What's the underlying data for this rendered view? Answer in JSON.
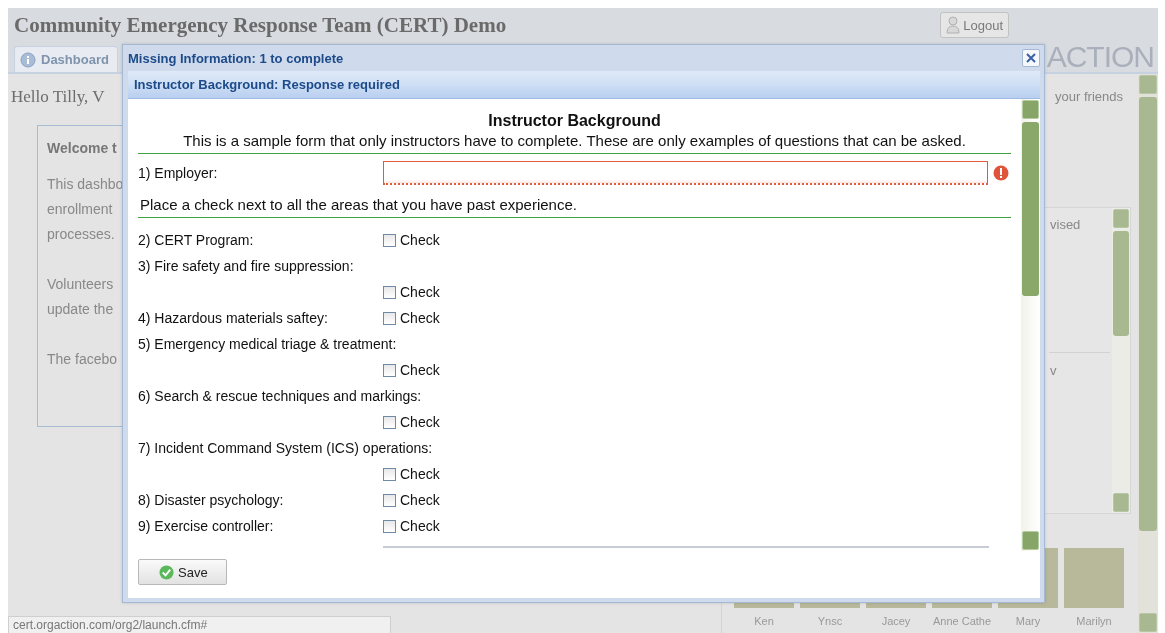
{
  "header": {
    "title": "Community Emergency Response Team (CERT) Demo",
    "logout": "Logout",
    "logo": "ACTION"
  },
  "tabs": [
    {
      "label": "Dashboard",
      "selected": true
    }
  ],
  "greeting": "Hello Tilly, V",
  "friends_label": "your friends",
  "welcome": {
    "title": "Welcome t",
    "paragraphs": [
      [
        "This dashbo",
        "enrollment",
        "processes."
      ],
      [
        "Volunteers",
        "update the"
      ],
      [
        "The facebo"
      ]
    ]
  },
  "side_panel": {
    "lines": [
      "vised",
      "v"
    ]
  },
  "people": [
    {
      "name": "Ken"
    },
    {
      "name": "Ynsc"
    },
    {
      "name": "Jacey"
    },
    {
      "name": "Anne Cathe"
    },
    {
      "name": "Mary"
    },
    {
      "name": "Marilyn"
    }
  ],
  "status_bar": "cert.orgaction.com/org2/launch.cfm#",
  "dialog": {
    "title": "Missing Information: 1 to complete",
    "subtitle": "Instructor Background: Response required",
    "form_title": "Instructor Background",
    "description": "This is a sample form that only instructors have to complete. These are only examples of questions that can be asked.",
    "employer": {
      "label": "1) Employer:",
      "invalid": true
    },
    "instruction": "Place a check next to all the areas that you have past experience.",
    "questions": [
      {
        "label": "2) CERT Program:",
        "option": "Check",
        "checked": false
      },
      {
        "label": "3) Fire safety and fire suppression:",
        "option": "Check",
        "checked": false
      },
      {
        "label": "4) Hazardous materials saftey:",
        "option": "Check",
        "checked": false
      },
      {
        "label": "5) Emergency medical triage & treatment:",
        "option": "Check",
        "checked": false
      },
      {
        "label": "6) Search & rescue techniques and markings:",
        "option": "Check",
        "checked": false
      },
      {
        "label": "7) Incident Command System (ICS) operations:",
        "option": "Check",
        "checked": false
      },
      {
        "label": "8) Disaster psychology:",
        "option": "Check",
        "checked": false
      },
      {
        "label": "9) Exercise controller:",
        "option": "Check",
        "checked": false
      }
    ],
    "save": "Save"
  }
}
